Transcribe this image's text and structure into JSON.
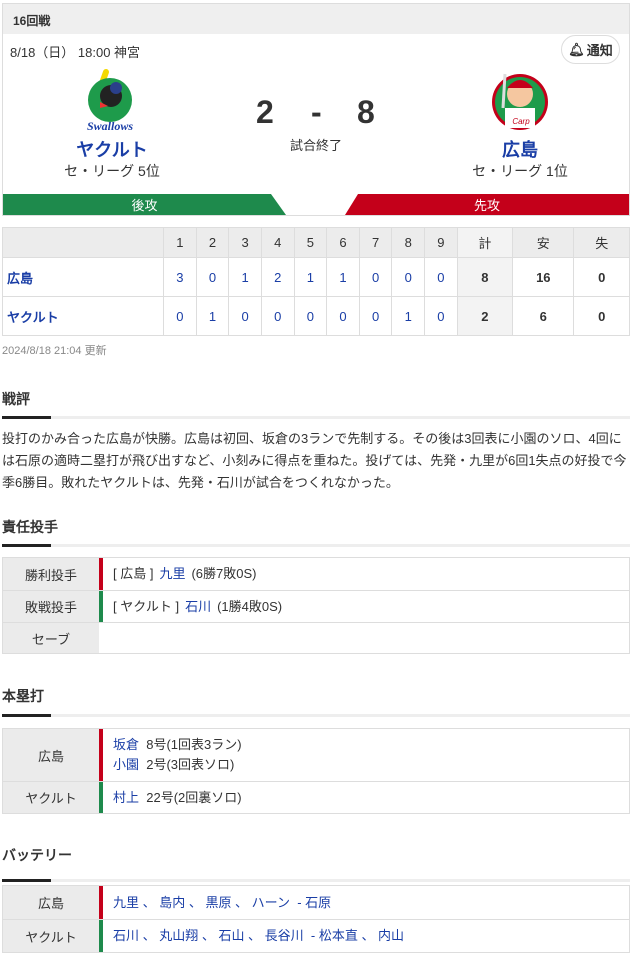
{
  "header": {
    "round": "16回戦",
    "datetime": "8/18（日） 18:00 神宮",
    "notify_label": "通知"
  },
  "home": {
    "name": "ヤクルト",
    "rank": "セ・リーグ 5位",
    "score": "2",
    "side": "後攻",
    "color": "#1e8a4c",
    "logo_text": "Swallows"
  },
  "away": {
    "name": "広島",
    "rank": "セ・リーグ 1位",
    "score": "8",
    "side": "先攻",
    "color": "#c4001a",
    "logo_text": "Carp"
  },
  "score_sep": "-",
  "status": "試合終了",
  "linescore": {
    "headers": [
      "1",
      "2",
      "3",
      "4",
      "5",
      "6",
      "7",
      "8",
      "9",
      "計",
      "安",
      "失"
    ],
    "rows": [
      {
        "team": "広島",
        "innings": [
          "3",
          "0",
          "1",
          "2",
          "1",
          "1",
          "0",
          "0",
          "0"
        ],
        "total": "8",
        "hits": "16",
        "errors": "0"
      },
      {
        "team": "ヤクルト",
        "innings": [
          "0",
          "1",
          "0",
          "0",
          "0",
          "0",
          "0",
          "1",
          "0"
        ],
        "total": "2",
        "hits": "6",
        "errors": "0"
      }
    ]
  },
  "updated": "2024/8/18 21:04 更新",
  "review": {
    "title": "戦評",
    "text": "投打のかみ合った広島が快勝。広島は初回、坂倉の3ランで先制する。その後は3回表に小園のソロ、4回には石原の適時二塁打が飛び出すなど、小刻みに得点を重ねた。投げては、先発・九里が6回1失点の好投で今季6勝目。敗れたヤクルトは、先発・石川が試合をつくれなかった。"
  },
  "pitchers": {
    "title": "責任投手",
    "rows": [
      {
        "label": "勝利投手",
        "team": "[ 広島 ]",
        "name": "九里",
        "record": "(6勝7敗0S)"
      },
      {
        "label": "敗戦投手",
        "team": "[ ヤクルト ]",
        "name": "石川",
        "record": "(1勝4敗0S)"
      },
      {
        "label": "セーブ",
        "team": "",
        "name": "",
        "record": ""
      }
    ]
  },
  "homeruns": {
    "title": "本塁打",
    "rows": [
      {
        "label": "広島",
        "items": [
          {
            "name": "坂倉",
            "detail": "8号(1回表3ラン)"
          },
          {
            "name": "小園",
            "detail": "2号(3回表ソロ)"
          }
        ]
      },
      {
        "label": "ヤクルト",
        "items": [
          {
            "name": "村上",
            "detail": "22号(2回裏ソロ)"
          }
        ]
      }
    ]
  },
  "battery": {
    "title": "バッテリー",
    "rows": [
      {
        "label": "広島",
        "text": "九里 、 島内 、 黒原 、 ハーン  - 石原"
      },
      {
        "label": "ヤクルト",
        "text": "石川 、 丸山翔 、 石山 、 長谷川  - 松本直 、 内山"
      }
    ]
  }
}
